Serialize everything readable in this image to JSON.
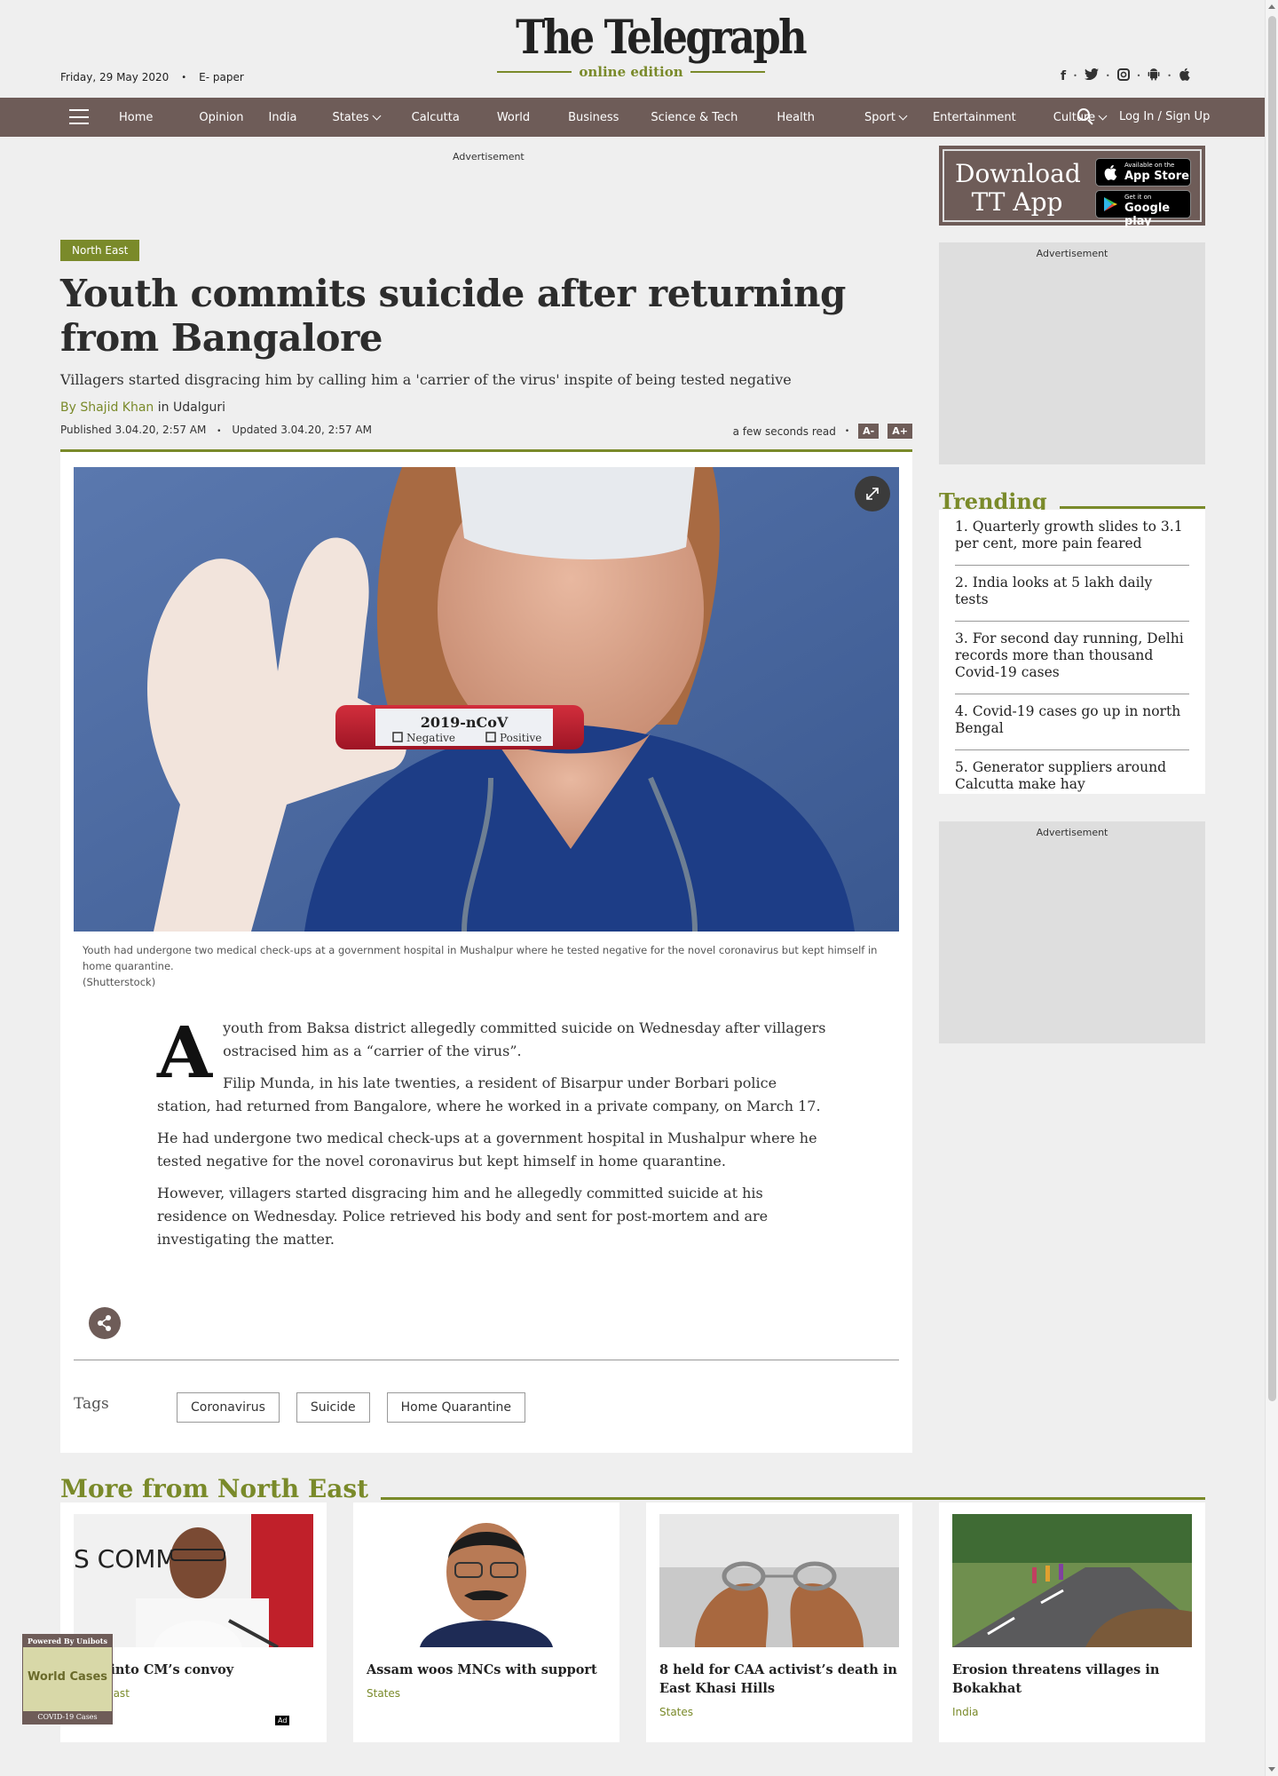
{
  "header": {
    "date": "Friday, 29 May 2020",
    "epaper": "E- paper",
    "logo": "The Telegraph",
    "logo_sub": "online edition",
    "social_icons": [
      "facebook-icon",
      "twitter-icon",
      "instagram-icon",
      "android-icon",
      "apple-icon"
    ]
  },
  "nav": {
    "items": [
      {
        "label": "Home",
        "dropdown": false
      },
      {
        "label": "Opinion",
        "dropdown": false
      },
      {
        "label": "India",
        "dropdown": false
      },
      {
        "label": "States",
        "dropdown": true
      },
      {
        "label": "Calcutta",
        "dropdown": false
      },
      {
        "label": "World",
        "dropdown": false
      },
      {
        "label": "Business",
        "dropdown": false
      },
      {
        "label": "Science & Tech",
        "dropdown": false
      },
      {
        "label": "Health",
        "dropdown": false
      },
      {
        "label": "Sport",
        "dropdown": true
      },
      {
        "label": "Entertainment",
        "dropdown": false
      },
      {
        "label": "Culture",
        "dropdown": true
      }
    ],
    "login": "Log In / Sign Up"
  },
  "ads": {
    "label": "Advertisement"
  },
  "article": {
    "section": "North East",
    "headline": "Youth commits suicide after returning from Bangalore",
    "standfirst": "Villagers started disgracing him by calling him a 'carrier of the virus' inspite of being tested negative",
    "by": "By",
    "author": "Shajid Khan",
    "in": "in",
    "location": "Udalguri",
    "published": "Published 3.04.20, 2:57 AM",
    "updated": "Updated 3.04.20, 2:57 AM",
    "read_time": "a few seconds read",
    "font_smaller": "A-",
    "font_larger": "A+",
    "image_text": {
      "tube_label": "2019-nCoV",
      "negative": "Negative",
      "positive": "Positive"
    },
    "caption": "Youth had undergone two medical check-ups at a government hospital in Mushalpur where he tested negative for the novel coronavirus but kept himself in home quarantine.",
    "credit": "(Shutterstock)",
    "dropcap": "A",
    "para1": "youth from Baksa district allegedly committed suicide on Wednesday after villagers ostracised him as a “carrier of the virus”.",
    "para1b": "Filip Munda, in his late twenties, a resident of Bisarpur under Borbari police station, had returned from Bangalore, where he worked in a private company, on March 17.",
    "para2": "He had undergone two medical check-ups at a government hospital in Mushalpur where he tested negative for the novel coronavirus but kept himself in home quarantine.",
    "para3": "However, villagers started disgracing him and he allegedly committed suicide at his residence on Wednesday. Police retrieved his body and sent for post-mortem and are investigating the matter.",
    "tags_label": "Tags",
    "tags": [
      "Coronavirus",
      "Suicide",
      "Home Quarantine"
    ]
  },
  "sidebar": {
    "app_title": "Download TT App",
    "app_store_small": "Available on the",
    "app_store": "App Store",
    "play_small": "Get it on",
    "play": "Google play",
    "trending_title": "Trending",
    "trending": [
      "1. Quarterly growth slides to 3.1 per cent, more pain feared",
      "2. India looks at 5 lakh daily tests",
      "3. For second day running, Delhi records more than thousand Covid-19 cases",
      "4. Covid-19 cases go up in north Bengal",
      "5. Generator suppliers around Calcutta make hay"
    ]
  },
  "more": {
    "title": "More from North East",
    "cards": [
      {
        "title": "reak into CM’s convoy",
        "section": "East"
      },
      {
        "title": "Assam woos MNCs with support",
        "section": "States"
      },
      {
        "title": "8 held for CAA activist’s death in East Khasi Hills",
        "section": "States"
      },
      {
        "title": "Erosion threatens villages in Bokakhat",
        "section": "India"
      }
    ]
  },
  "widget": {
    "powered": "Powered By Unibots",
    "title": "World Cases",
    "footer": "COVID-19 Cases",
    "ad": "Ad"
  },
  "colors": {
    "accent": "#7a8a2a",
    "nav": "#6e5c58"
  }
}
